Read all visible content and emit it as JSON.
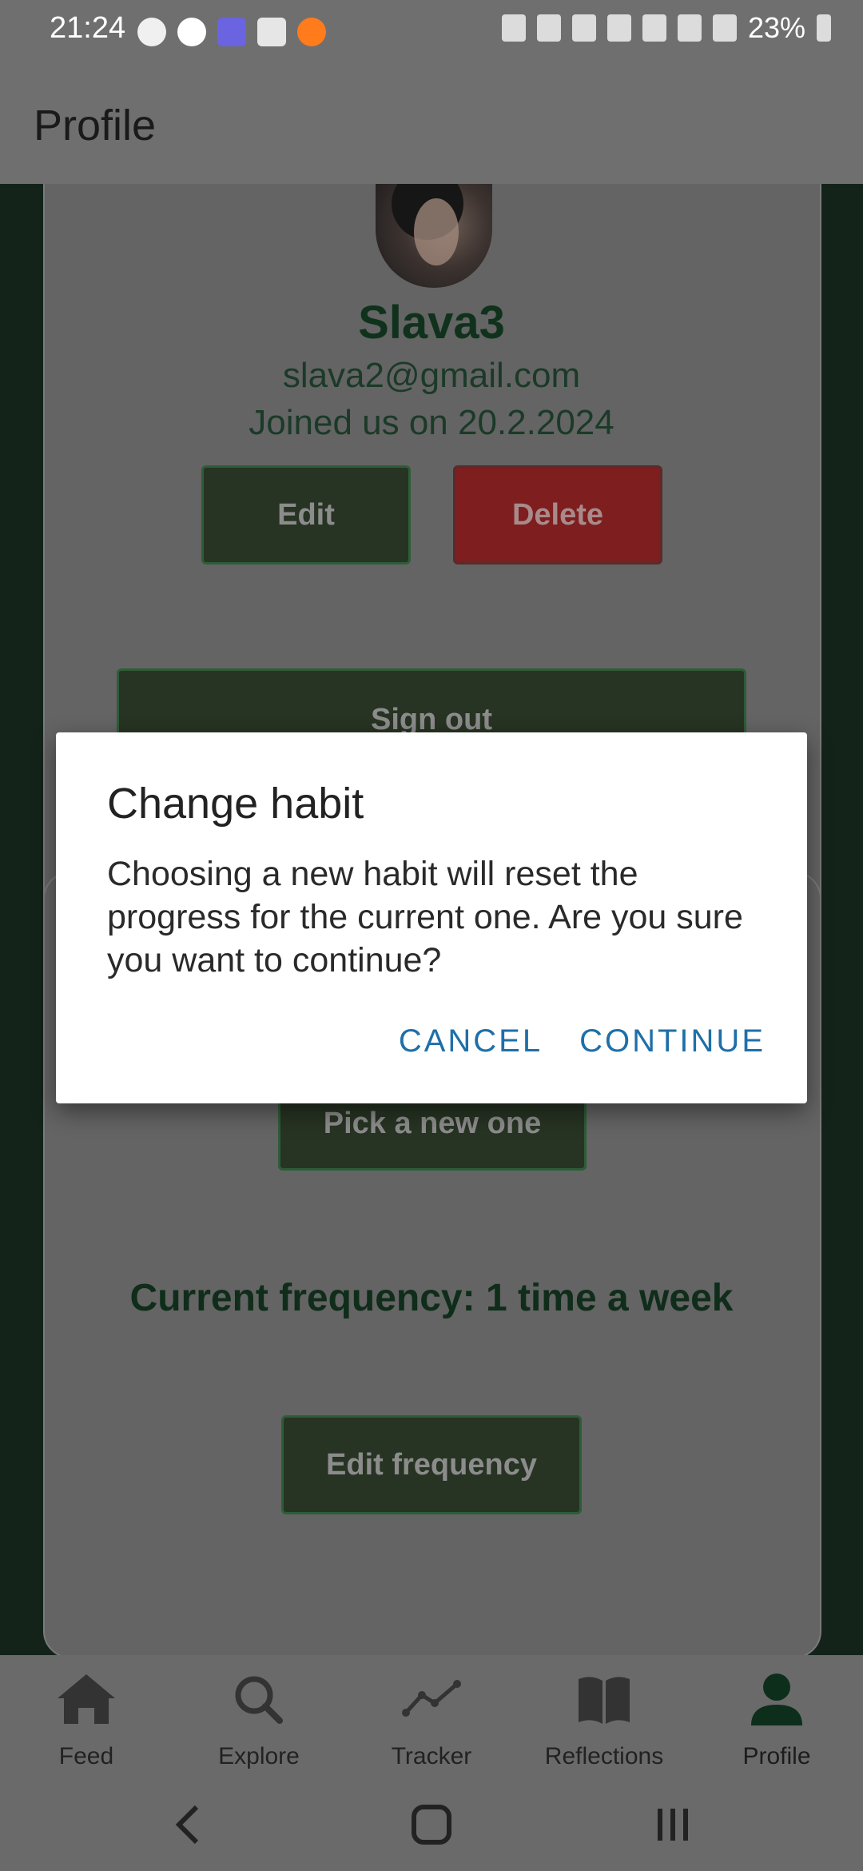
{
  "status_bar": {
    "time": "21:24",
    "battery": "23%"
  },
  "app_bar": {
    "title": "Profile"
  },
  "profile": {
    "name": "Slava3",
    "email": "slava2@gmail.com",
    "joined": "Joined us on 20.2.2024",
    "edit_label": "Edit",
    "delete_label": "Delete",
    "signout_label": "Sign out"
  },
  "habit": {
    "pick_label": "Pick a new one",
    "frequency_text": "Current frequency: 1 time a week",
    "edit_frequency_label": "Edit frequency"
  },
  "dialog": {
    "title": "Change habit",
    "body": "Choosing a new habit will reset the progress for the current one. Are you sure you want to continue?",
    "cancel_label": "CANCEL",
    "continue_label": "CONTINUE",
    "action_color": "#1f6fa8"
  },
  "bottom_nav": {
    "items": [
      {
        "label": "Feed",
        "icon": "home-icon"
      },
      {
        "label": "Explore",
        "icon": "search-icon"
      },
      {
        "label": "Tracker",
        "icon": "chart-line-icon"
      },
      {
        "label": "Reflections",
        "icon": "book-icon"
      },
      {
        "label": "Profile",
        "icon": "person-icon",
        "active": true
      }
    ]
  },
  "colors": {
    "primary_green": "#10321d",
    "delete_red": "#7e1e1f",
    "dialog_accent": "#1f6fa8"
  }
}
